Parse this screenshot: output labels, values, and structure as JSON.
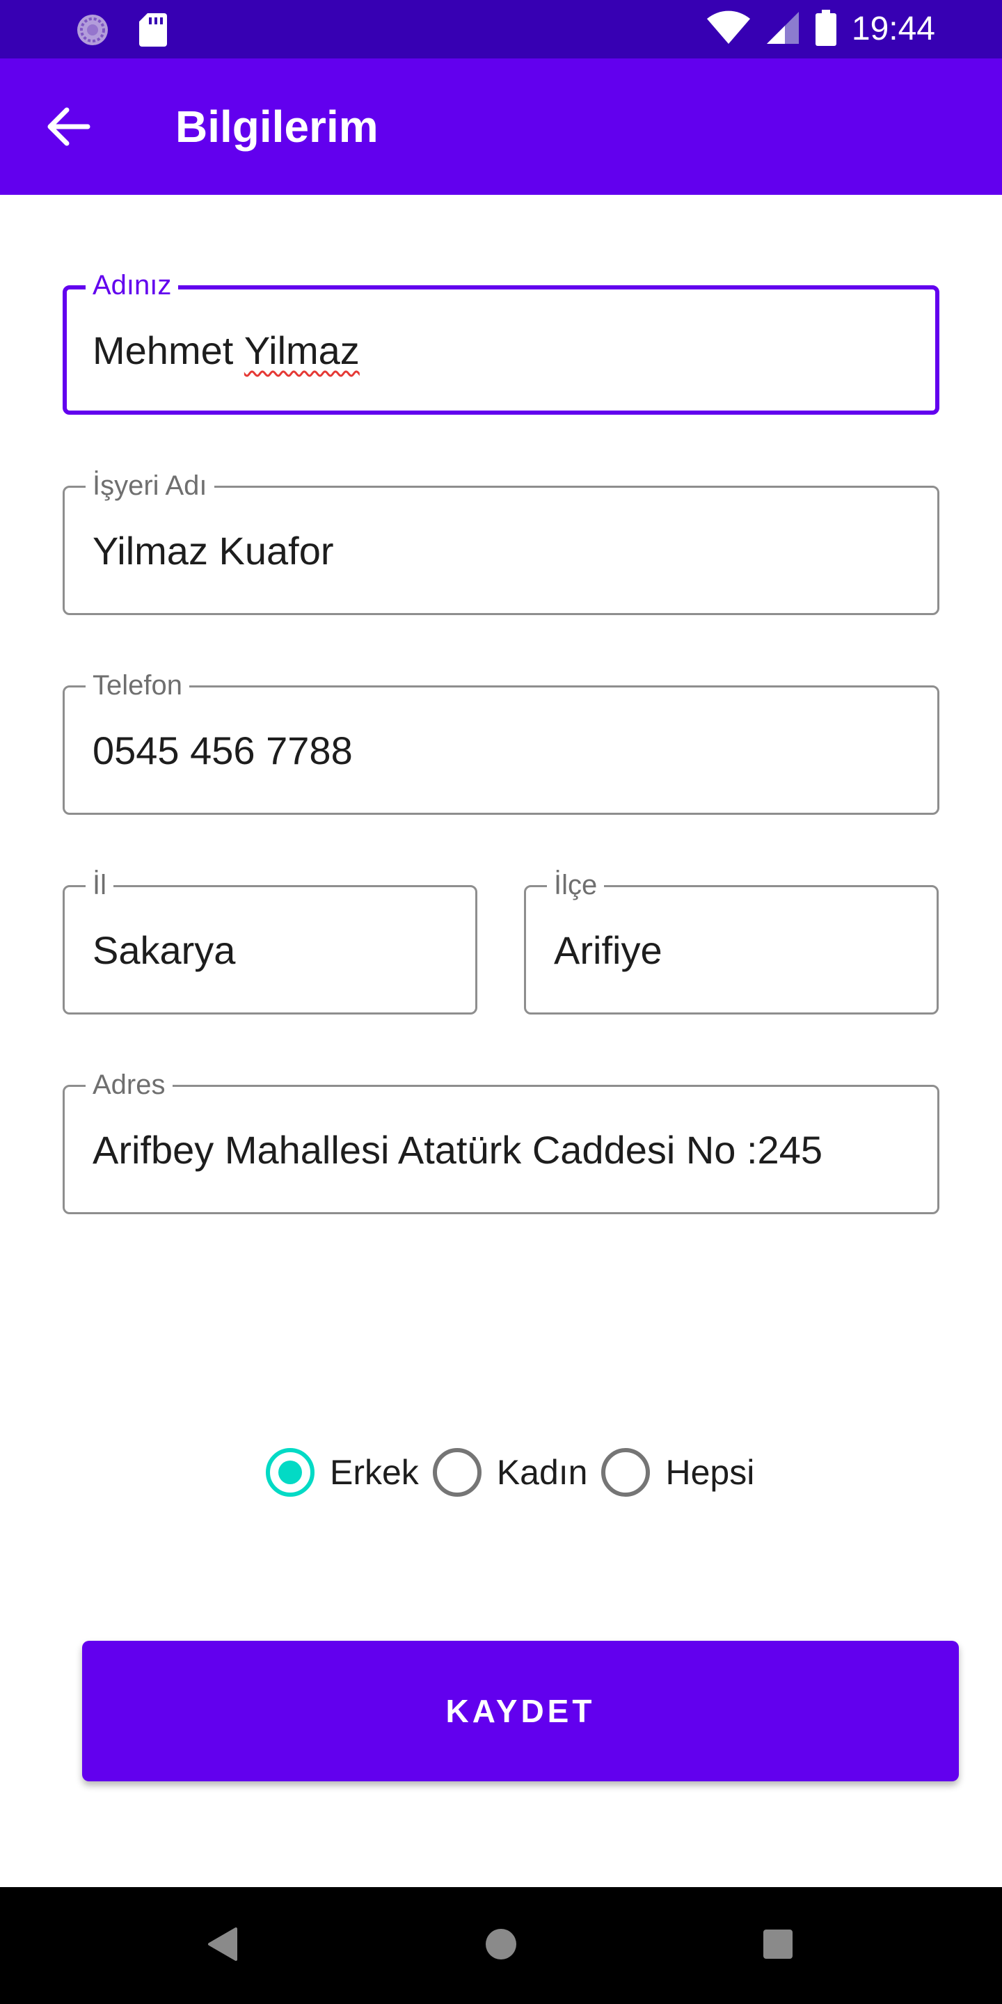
{
  "status_bar": {
    "time": "19:44",
    "left_icons": [
      "sync-icon",
      "sd-card-icon"
    ],
    "right_icons": [
      "wifi-icon",
      "signal-icon",
      "battery-icon"
    ]
  },
  "app_bar": {
    "title": "Bilgilerim",
    "back_icon": "arrow-back-icon",
    "background": "#6200EE",
    "status_background": "#3700B3"
  },
  "form": {
    "name": {
      "label": "Adınız",
      "value_first": "Mehmet ",
      "value_last": "Yilmaz",
      "focused": true
    },
    "business": {
      "label": "İşyeri Adı",
      "value": "Yilmaz Kuafor"
    },
    "phone": {
      "label": "Telefon",
      "value": "0545 456 7788"
    },
    "city": {
      "label": "İl",
      "value": "Sakarya"
    },
    "district": {
      "label": "İlçe",
      "value": "Arifiye"
    },
    "address": {
      "label": "Adres",
      "value": "Arifbey Mahallesi Atatürk Caddesi No :245"
    }
  },
  "gender": {
    "options": [
      {
        "label": "Erkek",
        "checked": true
      },
      {
        "label": "Kadın",
        "checked": false
      },
      {
        "label": "Hepsi",
        "checked": false
      }
    ],
    "accent": "#03DAC5"
  },
  "save_button": {
    "label": "KAYDET",
    "color": "#6200EE"
  },
  "nav_bar": {
    "icons": [
      "back-triangle-icon",
      "home-circle-icon",
      "recents-square-icon"
    ]
  }
}
